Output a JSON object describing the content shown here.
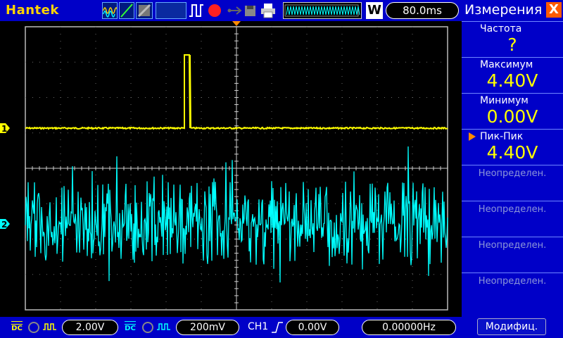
{
  "topbar": {
    "brand": "Hantek",
    "timebase": "80.0ms",
    "w_label": "W",
    "icons": [
      "waveform-icon",
      "ramp-icon",
      "grayscale-icon",
      "pulse-icon",
      "record-icon",
      "usb-icon",
      "memory-icon",
      "printer-icon"
    ]
  },
  "panel": {
    "title": "Измерения",
    "close_label": "X",
    "measurements": [
      {
        "label": "Частота",
        "value": "?"
      },
      {
        "label": "Максимум",
        "value": "4.40V"
      },
      {
        "label": "Минимум",
        "value": "0.00V"
      },
      {
        "label": "Пик-Пик",
        "value": "4.40V"
      }
    ],
    "empty_slots": [
      "Неопределен.",
      "Неопределен.",
      "Неопределен.",
      "Неопределен."
    ],
    "modify_label": "Модифиц."
  },
  "channels": {
    "ch1": {
      "marker": "1",
      "color": "#ffff00",
      "volts_div": "2.00V",
      "coupling": "DC"
    },
    "ch2": {
      "marker": "2",
      "color": "#00ffff",
      "volts_div": "200mV",
      "coupling": "DC"
    }
  },
  "trigger": {
    "source": "CH1",
    "level": "0.00V",
    "frequency": "0.00000Hz"
  },
  "colors": {
    "bar": "#0000c8",
    "accent": "#ffd400",
    "ch1": "#ffff00",
    "ch2": "#00ffff",
    "close": "#ff5a00"
  }
}
